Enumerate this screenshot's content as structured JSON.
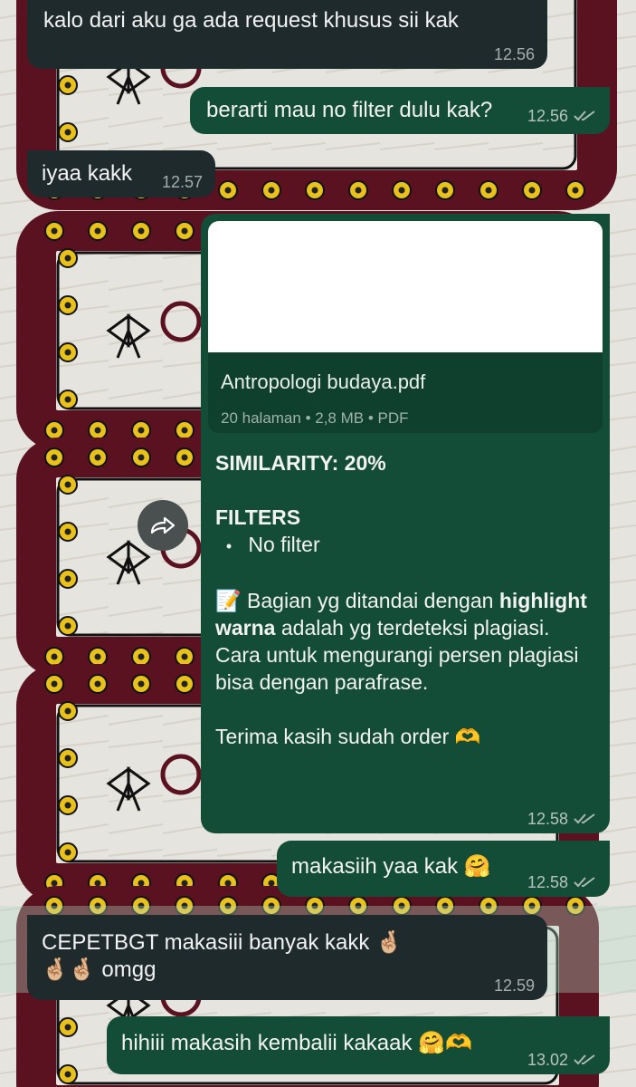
{
  "messages": [
    {
      "dir": "in",
      "text": "kalo dari aku ga ada request khusus sii kak",
      "time": "12.56"
    },
    {
      "dir": "out",
      "text": "berarti mau no filter dulu kak?",
      "time": "12.56"
    },
    {
      "dir": "in",
      "text": "iyaa kakk",
      "time": "12.57"
    },
    {
      "dir": "out",
      "text": "makasiih yaa kak 🤗",
      "time": "12.58"
    },
    {
      "dir": "in",
      "text": "CEPETBGT makasiii banyak kakk 🤞🏼🤞🏼🤞🏼 omgg",
      "time": "12.59"
    },
    {
      "dir": "out",
      "text": "hihiii makasih kembalii kakaak 🤗🫶",
      "time": "13.02"
    }
  ],
  "document_message": {
    "file_name": "Antropologi budaya.pdf",
    "file_info": "20 halaman • 2,8 MB • PDF",
    "similarity": "SIMILARITY: 20%",
    "filters_heading": "FILTERS",
    "filter_bullet": "•",
    "filter_item": "No filter",
    "note_icon": "📝",
    "note_part1": "Bagian yg ditandai dengan",
    "note_bold": "highlight warna",
    "note_part2": "adalah yg terdeteksi plagiasi. Cara untuk mengurangi persen plagiasi bisa dengan parafrase.",
    "thanks": "Terima kasih sudah order 🫶",
    "time": "12.58"
  },
  "icons": {
    "forward": "forward-arrow-icon",
    "read_receipt": "double-check-icon"
  },
  "colors": {
    "incoming_bubble": "#1f2a2c",
    "outgoing_bubble": "#134d37",
    "wallpaper_frame": "#5a1220",
    "flower": "#e8c21a"
  }
}
